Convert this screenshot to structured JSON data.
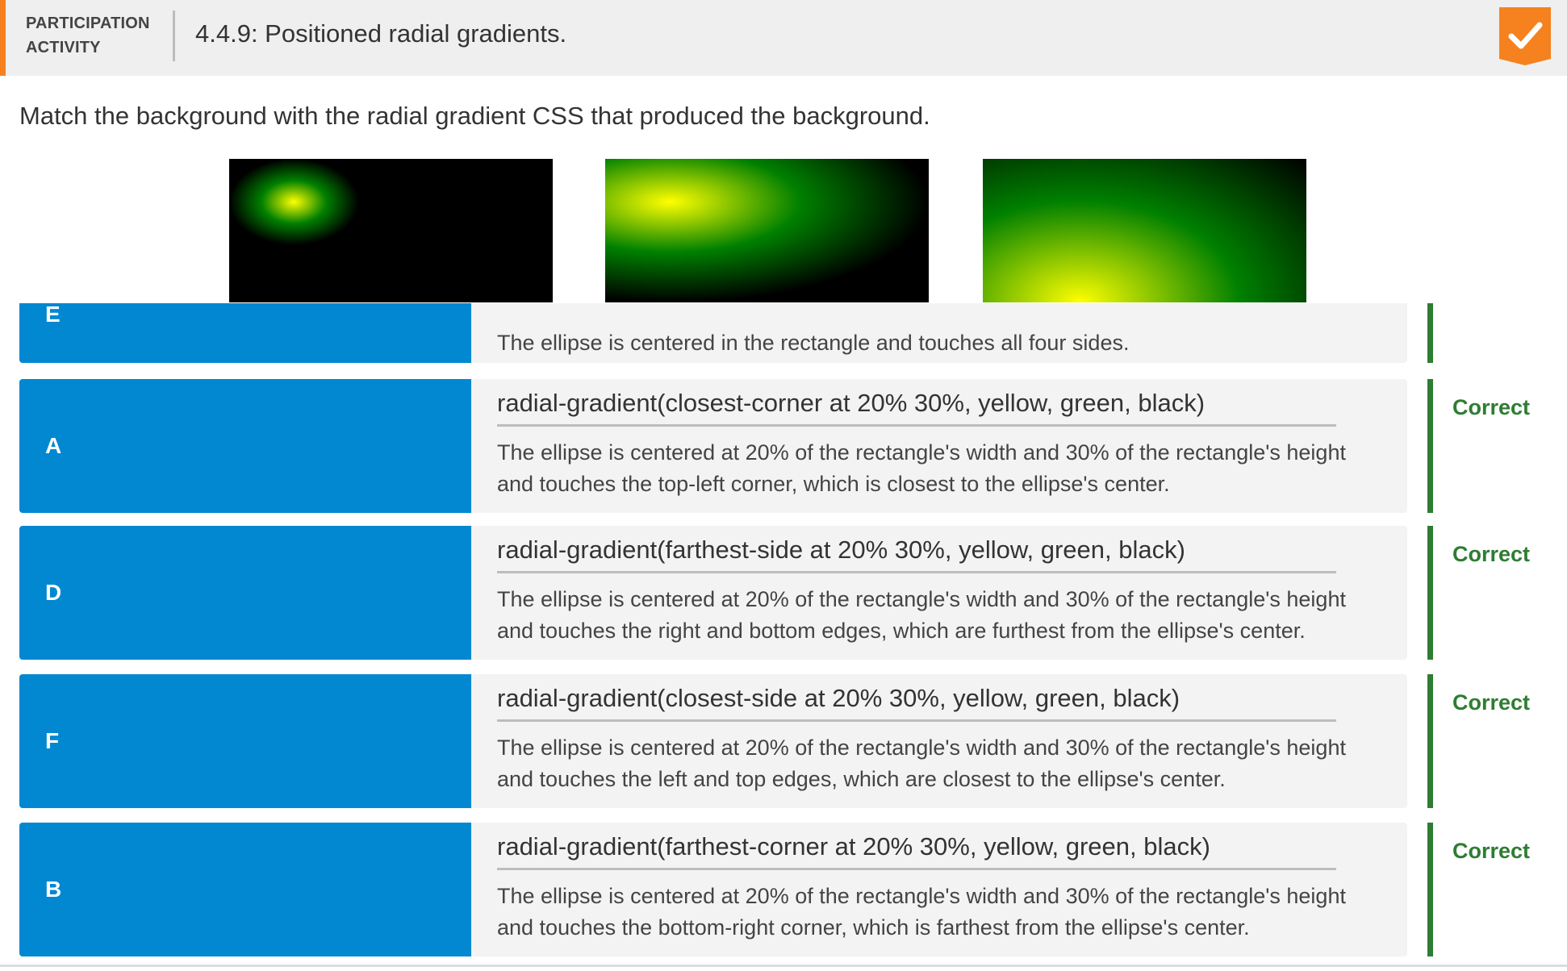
{
  "header": {
    "type_label": "PARTICIPATION\nACTIVITY",
    "title": "4.4.9: Positioned radial gradients.",
    "accent_color": "#f5821f",
    "status_icon": "checkmark-badge-icon"
  },
  "instructions": "Match the background with the radial gradient CSS that produced the background.",
  "swatches": [
    {
      "name": "gradient-preview-1"
    },
    {
      "name": "gradient-preview-2"
    },
    {
      "name": "gradient-preview-3"
    }
  ],
  "rows": [
    {
      "letter": "E",
      "css": "",
      "explanation": "The ellipse is centered in the rectangle and touches all four sides.",
      "status": ""
    },
    {
      "letter": "A",
      "css": "radial-gradient(closest-corner at 20% 30%, yellow, green, black)",
      "explanation": "The ellipse is centered at 20% of the rectangle's width and 30% of the rectangle's height and touches the top-left corner, which is closest to the ellipse's center.",
      "status": "Correct"
    },
    {
      "letter": "D",
      "css": "radial-gradient(farthest-side at 20% 30%, yellow, green, black)",
      "explanation": "The ellipse is centered at 20% of the rectangle's width and 30% of the rectangle's height and touches the right and bottom edges, which are furthest from the ellipse's center.",
      "status": "Correct"
    },
    {
      "letter": "F",
      "css": "radial-gradient(closest-side at 20% 30%, yellow, green, black)",
      "explanation": "The ellipse is centered at 20% of the rectangle's width and 30% of the rectangle's height and touches the left and top edges, which are closest to the ellipse's center.",
      "status": "Correct"
    },
    {
      "letter": "B",
      "css": "radial-gradient(farthest-corner at 20% 30%, yellow, green, black)",
      "explanation": "The ellipse is centered at 20% of the rectangle's width and 30% of the rectangle's height and touches the bottom-right corner, which is farthest from the ellipse's center.",
      "status": "Correct"
    }
  ],
  "colors": {
    "letter_box": "#0288d1",
    "answer_box": "#f3f3f3",
    "correct": "#2e7d32"
  }
}
